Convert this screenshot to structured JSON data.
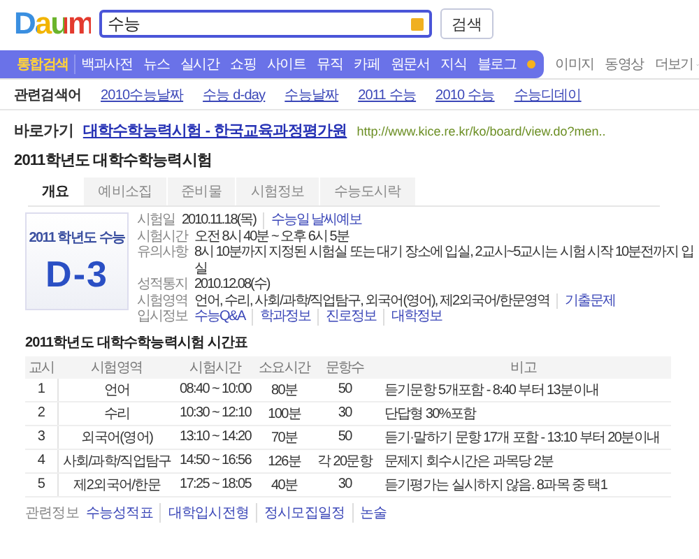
{
  "header": {
    "logo": "Daum",
    "search": {
      "value": "수능"
    },
    "search_button": "검색"
  },
  "nav": {
    "items": [
      {
        "label": "통합검색",
        "selected": true
      },
      {
        "label": "백과사전",
        "selected": false
      },
      {
        "label": "뉴스",
        "selected": false
      },
      {
        "label": "실시간",
        "selected": false
      },
      {
        "label": "쇼핑",
        "selected": false
      },
      {
        "label": "사이트",
        "selected": false
      },
      {
        "label": "뮤직",
        "selected": false
      },
      {
        "label": "카페",
        "selected": false
      },
      {
        "label": "원문서",
        "selected": false
      },
      {
        "label": "지식",
        "selected": false
      },
      {
        "label": "블로그",
        "selected": false
      }
    ],
    "extra": [
      "이미지",
      "동영상",
      "더보기"
    ]
  },
  "related_searches": {
    "label": "관련검색어",
    "items": [
      "2010수능날짜",
      "수능 d-day",
      "수능날짜",
      "2011 수능",
      "2010 수능",
      "수능디데이"
    ]
  },
  "shortcut": {
    "label": "바로가기",
    "title": "대학수학능력시험 - 한국교육과정평가원",
    "url": "http://www.kice.re.kr/ko/board/view.do?men.."
  },
  "section_title": "2011학년도 대학수학능력시험",
  "tabs": [
    {
      "label": "개요",
      "selected": true
    },
    {
      "label": "예비소집",
      "selected": false
    },
    {
      "label": "준비물",
      "selected": false
    },
    {
      "label": "시험정보",
      "selected": false
    },
    {
      "label": "수능도시락",
      "selected": false
    }
  ],
  "dday_card": {
    "caption": "2011 학년도 수능",
    "count": "D-3"
  },
  "info": [
    {
      "label": "시험일",
      "parts": [
        {
          "kind": "text",
          "text": "2010.11.18(목)"
        },
        {
          "kind": "link",
          "text": "수능일 날씨예보"
        }
      ]
    },
    {
      "label": "시험시간",
      "parts": [
        {
          "kind": "text",
          "text": "오전 8시 40분 ~ 오후 6시 5분"
        }
      ]
    },
    {
      "label": "유의사항",
      "parts": [
        {
          "kind": "text",
          "text": "8시 10분까지 지정된 시험실 또는 대기 장소에 입실, 2교시~5교시는 시험 시작 10분전까지 입실"
        }
      ]
    },
    {
      "label": "성적통지",
      "parts": [
        {
          "kind": "text",
          "text": "2010.12.08(수)"
        }
      ]
    },
    {
      "label": "시험영역",
      "parts": [
        {
          "kind": "text",
          "text": "언어, 수리, 사회/과학/직업탐구, 외국어(영어), 제2외국어/한문영역"
        },
        {
          "kind": "link",
          "text": "기출문제"
        }
      ]
    },
    {
      "label": "입시정보",
      "parts": [
        {
          "kind": "link",
          "text": "수능Q&A"
        },
        {
          "kind": "link",
          "text": "학과정보"
        },
        {
          "kind": "link",
          "text": "진로정보"
        },
        {
          "kind": "link",
          "text": "대학정보"
        }
      ]
    }
  ],
  "timetable": {
    "title": "2011학년도 대학수학능력시험 시간표",
    "columns": [
      "교시",
      "시험영역",
      "시험시간",
      "소요시간",
      "문항수",
      "비고"
    ],
    "rows": [
      [
        "1",
        "언어",
        "08:40 ~ 10:00",
        "80분",
        "50",
        "듣기문항 5개포함 - 8:40 부터 13분이내"
      ],
      [
        "2",
        "수리",
        "10:30 ~ 12:10",
        "100분",
        "30",
        "단답형 30%포함"
      ],
      [
        "3",
        "외국어(영어)",
        "13:10 ~ 14:20",
        "70분",
        "50",
        "듣기·말하기 문항 17개 포함 - 13:10 부터 20분이내"
      ],
      [
        "4",
        "사회/과학/직업탐구",
        "14:50 ~ 16:56",
        "126분",
        "각 20문항",
        "문제지 회수시간은 과목당 2분"
      ],
      [
        "5",
        "제2외국어/한문",
        "17:25 ~ 18:05",
        "40분",
        "30",
        "듣기평가는 실시하지 않음. 8과목 중 택1"
      ]
    ]
  },
  "related_info": {
    "label": "관련정보",
    "links": [
      "수능성적표",
      "대학입시전형",
      "정시모집일정",
      "논술"
    ]
  }
}
